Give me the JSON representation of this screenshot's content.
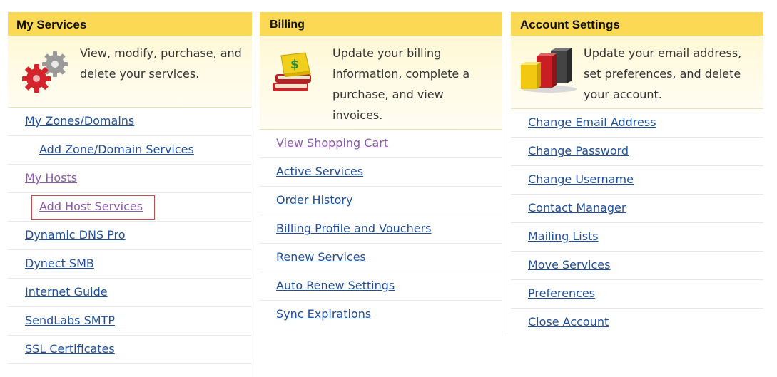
{
  "columns": [
    {
      "title": "My Services",
      "icon": "gears-icon",
      "description": "View, modify, purchase, and delete your services.",
      "links": [
        {
          "label": "My Zones/Domains"
        },
        {
          "label": "Add Zone/Domain Services"
        },
        {
          "label": "My Hosts"
        },
        {
          "label": "Add Host Services"
        },
        {
          "label": "Dynamic DNS Pro"
        },
        {
          "label": "Dynect SMB"
        },
        {
          "label": "Internet Guide"
        },
        {
          "label": "SendLabs SMTP"
        },
        {
          "label": "SSL Certificates"
        }
      ]
    },
    {
      "title": "Billing",
      "icon": "books-dollar-icon",
      "description": "Update your billing information, complete a purchase, and view invoices.",
      "links": [
        {
          "label": "View Shopping Cart"
        },
        {
          "label": "Active Services"
        },
        {
          "label": "Order History"
        },
        {
          "label": "Billing Profile and Vouchers"
        },
        {
          "label": "Renew Services"
        },
        {
          "label": "Auto Renew Settings"
        },
        {
          "label": "Sync Expirations"
        }
      ]
    },
    {
      "title": "Account Settings",
      "icon": "colored-blocks-icon",
      "description": "Update your email address, set preferences, and delete your account.",
      "links": [
        {
          "label": "Change Email Address"
        },
        {
          "label": "Change Password"
        },
        {
          "label": "Change Username"
        },
        {
          "label": "Contact Manager"
        },
        {
          "label": "Mailing Lists"
        },
        {
          "label": "Move Services"
        },
        {
          "label": "Preferences"
        },
        {
          "label": "Close Account"
        }
      ]
    }
  ],
  "colors": {
    "header_bg": "#fcd955",
    "intro_bg": "#fff8d6",
    "link": "#1f4e9b",
    "visited_link": "#8a5aa6",
    "highlight_border": "#c94a4a"
  }
}
